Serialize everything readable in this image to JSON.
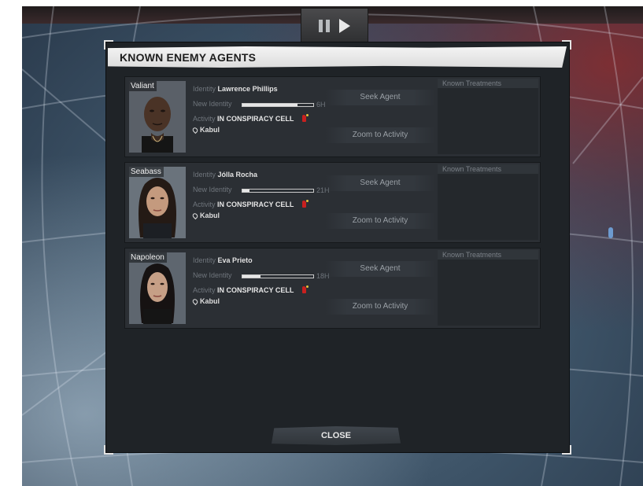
{
  "dialog": {
    "title": "KNOWN ENEMY AGENTS",
    "close_label": "CLOSE"
  },
  "labels": {
    "identity": "Identity",
    "new_identity": "New Identity",
    "activity": "Activity",
    "seek_agent": "Seek Agent",
    "zoom_to_activity": "Zoom to Activity",
    "known_treatments": "Known Treatments"
  },
  "agents": [
    {
      "codename": "Valiant",
      "identity": "Lawrence Phillips",
      "new_identity_progress": 0.78,
      "new_identity_time": "6H",
      "activity": "IN CONSPIRACY CELL",
      "location": "Kabul",
      "portrait": "male-agent-portrait"
    },
    {
      "codename": "Seabass",
      "identity": "Jólla Rocha",
      "new_identity_progress": 0.1,
      "new_identity_time": "21H",
      "activity": "IN CONSPIRACY CELL",
      "location": "Kabul",
      "portrait": "female-agent-portrait"
    },
    {
      "codename": "Napoleon",
      "identity": "Eva Prieto",
      "new_identity_progress": 0.25,
      "new_identity_time": "18H",
      "activity": "IN CONSPIRACY CELL",
      "location": "Kabul",
      "portrait": "female-agent-portrait"
    }
  ],
  "icons": {
    "pause": "pause-icon",
    "play": "play-icon",
    "location": "location-pin-icon",
    "conspiracy": "red-fist-icon"
  },
  "colors": {
    "conspiracy_red": "#c8201f",
    "panel_bg": "#1f2327",
    "card_bg": "#2b2f34"
  }
}
